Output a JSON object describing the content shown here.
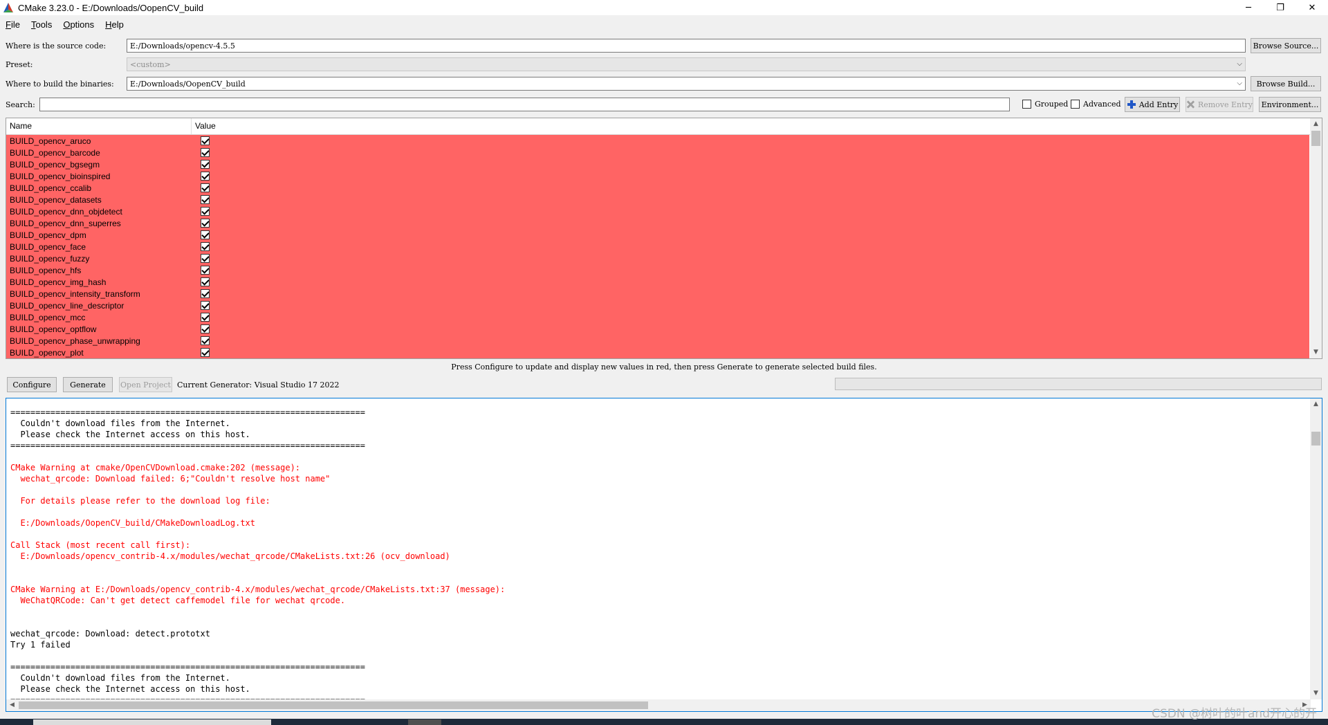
{
  "window": {
    "title": "CMake 3.23.0 - E:/Downloads/OopenCV_build",
    "minimize": "─",
    "maximize": "❐",
    "close": "✕"
  },
  "menu": [
    {
      "accel": "F",
      "rest": "ile"
    },
    {
      "accel": "T",
      "rest": "ools"
    },
    {
      "accel": "O",
      "rest": "ptions"
    },
    {
      "accel": "H",
      "rest": "elp"
    }
  ],
  "source": {
    "label": "Where is the source code:",
    "value": "E:/Downloads/opencv-4.5.5",
    "button": "Browse Source..."
  },
  "preset": {
    "label": "Preset:",
    "value": "<custom>"
  },
  "binaries": {
    "label": "Where to build the binaries:",
    "value": "E:/Downloads/OopenCV_build",
    "button": "Browse Build..."
  },
  "search": {
    "label": "Search:",
    "value": ""
  },
  "options": {
    "grouped": "Grouped",
    "advanced": "Advanced",
    "add_entry": "Add Entry",
    "remove_entry": "Remove Entry",
    "environment": "Environment..."
  },
  "table": {
    "headers": [
      "Name",
      "Value"
    ],
    "rows": [
      "BUILD_opencv_aruco",
      "BUILD_opencv_barcode",
      "BUILD_opencv_bgsegm",
      "BUILD_opencv_bioinspired",
      "BUILD_opencv_ccalib",
      "BUILD_opencv_datasets",
      "BUILD_opencv_dnn_objdetect",
      "BUILD_opencv_dnn_superres",
      "BUILD_opencv_dpm",
      "BUILD_opencv_face",
      "BUILD_opencv_fuzzy",
      "BUILD_opencv_hfs",
      "BUILD_opencv_img_hash",
      "BUILD_opencv_intensity_transform",
      "BUILD_opencv_line_descriptor",
      "BUILD_opencv_mcc",
      "BUILD_opencv_optflow",
      "BUILD_opencv_phase_unwrapping",
      "BUILD_opencv_plot"
    ],
    "row_color": "#ff6464"
  },
  "hint": "Press Configure to update and display new values in red, then press Generate to generate selected build files.",
  "actions": {
    "configure": "Configure",
    "generate": "Generate",
    "open_project": "Open Project",
    "generator": "Current Generator: Visual Studio 17 2022"
  },
  "log": [
    {
      "text": "=======================================================================",
      "warn": false
    },
    {
      "text": "  Couldn't download files from the Internet.",
      "warn": false
    },
    {
      "text": "  Please check the Internet access on this host.",
      "warn": false
    },
    {
      "text": "=======================================================================",
      "warn": false
    },
    {
      "text": "",
      "warn": false
    },
    {
      "text": "CMake Warning at cmake/OpenCVDownload.cmake:202 (message):",
      "warn": true
    },
    {
      "text": "  wechat_qrcode: Download failed: 6;\"Couldn't resolve host name\"",
      "warn": true
    },
    {
      "text": "",
      "warn": true
    },
    {
      "text": "  For details please refer to the download log file:",
      "warn": true
    },
    {
      "text": "",
      "warn": true
    },
    {
      "text": "  E:/Downloads/OopenCV_build/CMakeDownloadLog.txt",
      "warn": true
    },
    {
      "text": "",
      "warn": true
    },
    {
      "text": "Call Stack (most recent call first):",
      "warn": true
    },
    {
      "text": "  E:/Downloads/opencv_contrib-4.x/modules/wechat_qrcode/CMakeLists.txt:26 (ocv_download)",
      "warn": true
    },
    {
      "text": "",
      "warn": true
    },
    {
      "text": "",
      "warn": true
    },
    {
      "text": "CMake Warning at E:/Downloads/opencv_contrib-4.x/modules/wechat_qrcode/CMakeLists.txt:37 (message):",
      "warn": true
    },
    {
      "text": "  WeChatQRCode: Can't get detect caffemodel file for wechat qrcode.",
      "warn": true
    },
    {
      "text": "",
      "warn": false
    },
    {
      "text": "",
      "warn": false
    },
    {
      "text": "wechat_qrcode: Download: detect.prototxt",
      "warn": false
    },
    {
      "text": "Try 1 failed",
      "warn": false
    },
    {
      "text": "",
      "warn": false
    },
    {
      "text": "=======================================================================",
      "warn": false
    },
    {
      "text": "  Couldn't download files from the Internet.",
      "warn": false
    },
    {
      "text": "  Please check the Internet access on this host.",
      "warn": false
    },
    {
      "text": "=======================================================================",
      "warn": false
    }
  ],
  "watermark": "CSDN @树叶的叶and开心的开",
  "colors": {
    "warning": "#ff0000",
    "changed_row": "#ff6464",
    "focus": "#0078d7"
  }
}
